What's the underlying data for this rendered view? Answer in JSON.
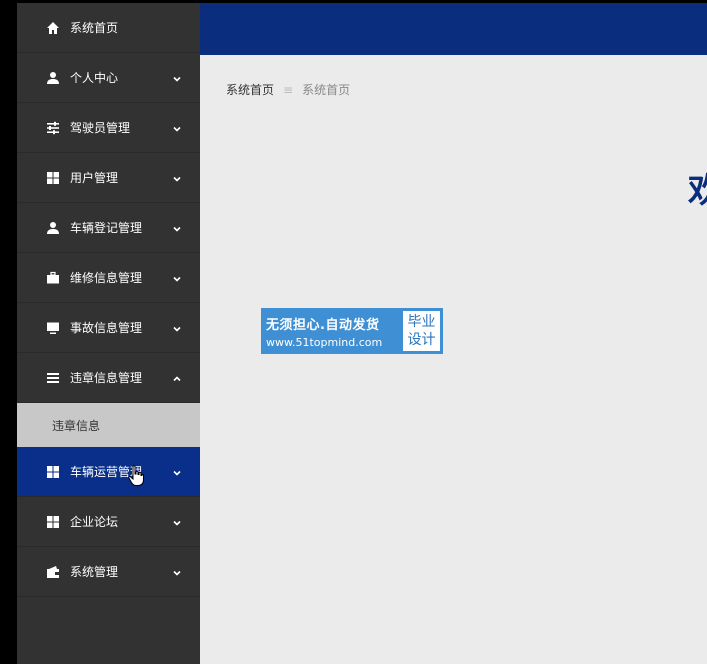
{
  "sidebar": {
    "items": [
      {
        "label": "系统首页",
        "icon": "home-icon",
        "has_chevron": false
      },
      {
        "label": "个人中心",
        "icon": "user-icon",
        "has_chevron": true
      },
      {
        "label": "驾驶员管理",
        "icon": "sliders-icon",
        "has_chevron": true
      },
      {
        "label": "用户管理",
        "icon": "grid-icon",
        "has_chevron": true
      },
      {
        "label": "车辆登记管理",
        "icon": "user-icon",
        "has_chevron": true
      },
      {
        "label": "维修信息管理",
        "icon": "briefcase-icon",
        "has_chevron": true
      },
      {
        "label": "事故信息管理",
        "icon": "monitor-icon",
        "has_chevron": true
      },
      {
        "label": "违章信息管理",
        "icon": "list-icon",
        "has_chevron": true,
        "expanded": true
      },
      {
        "label": "车辆运营管理",
        "icon": "grid-icon",
        "has_chevron": true,
        "active": true
      },
      {
        "label": "企业论坛",
        "icon": "grid-icon",
        "has_chevron": true
      },
      {
        "label": "系统管理",
        "icon": "wallet-icon",
        "has_chevron": true
      }
    ],
    "submenu": {
      "label": "违章信息"
    }
  },
  "breadcrumb": {
    "home": "系统首页",
    "separator": "≡",
    "current": "系统首页"
  },
  "welcome": {
    "text": "欢"
  },
  "watermark": {
    "line1": "无须担心.自动发货",
    "line2": "www.51topmind.com",
    "badge_line1": "毕业",
    "badge_line2": "设计"
  },
  "colors": {
    "sidebar_bg": "#323232",
    "active_bg": "#0a2f8a",
    "topbar_bg": "#0a2d7d",
    "content_bg": "#ebebeb"
  }
}
